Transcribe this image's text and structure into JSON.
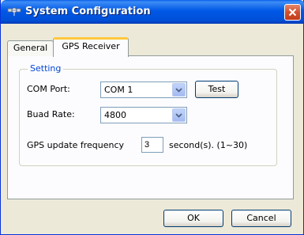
{
  "window": {
    "title": "System Configuration"
  },
  "tabs": [
    {
      "label": "General",
      "active": false
    },
    {
      "label": "GPS Receiver",
      "active": true
    }
  ],
  "setting": {
    "group_label": "Setting",
    "com_port_label": "COM Port:",
    "com_port_value": "COM 1",
    "test_label": "Test",
    "baud_rate_label": "Buad Rate:",
    "baud_rate_value": "4800",
    "update_freq_label": "GPS update frequency",
    "update_freq_value": "3",
    "update_freq_unit": "second(s). (1~30)"
  },
  "footer": {
    "ok_label": "OK",
    "cancel_label": "Cancel"
  },
  "colors": {
    "title_bar": "#0054e3",
    "group_label": "#0046d5",
    "close_button": "#d3502c",
    "active_tab_accent": "#ffc83c"
  }
}
